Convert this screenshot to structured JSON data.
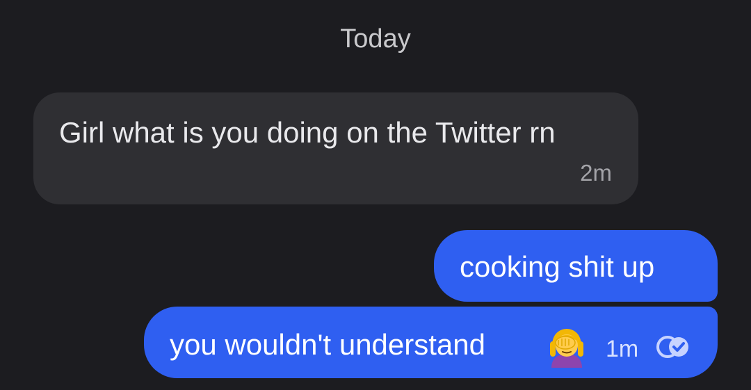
{
  "conversation": {
    "date_divider": "Today",
    "messages": [
      {
        "direction": "incoming",
        "text": "Girl what is you doing on the Twitter rn",
        "time": "2m"
      },
      {
        "direction": "outgoing",
        "text": "cooking shit up"
      },
      {
        "direction": "outgoing",
        "text": "you wouldn't understand",
        "emoji": "face-palm-woman-icon",
        "time": "1m",
        "status_icon": "read-receipt-icon"
      }
    ]
  },
  "colors": {
    "background": "#1c1c20",
    "incoming_bubble": "#2f2f33",
    "outgoing_bubble": "#2f5ff1"
  }
}
